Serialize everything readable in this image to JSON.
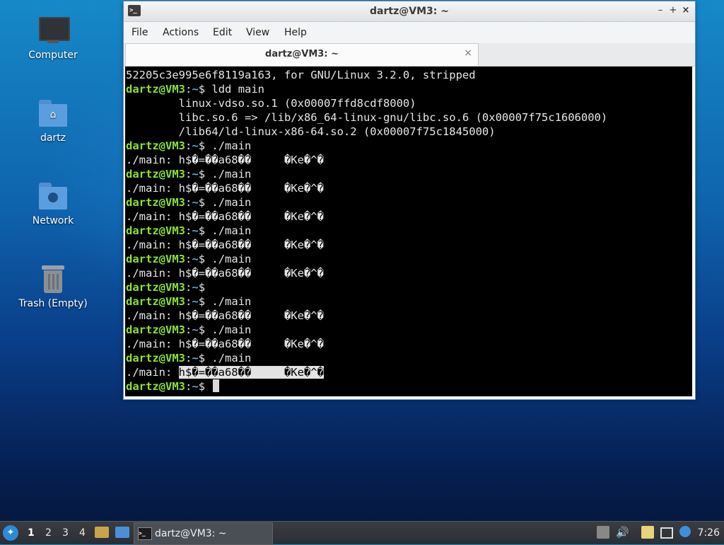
{
  "desktop": {
    "icons": [
      {
        "label": "Computer"
      },
      {
        "label": "dartz"
      },
      {
        "label": "Network"
      },
      {
        "label": "Trash (Empty)"
      }
    ]
  },
  "window": {
    "title": "dartz@VM3: ~",
    "controls": {
      "minimize": "–",
      "maximize": "+",
      "close": "×"
    },
    "menu": [
      "File",
      "Actions",
      "Edit",
      "View",
      "Help"
    ],
    "tab": {
      "label": "dartz@VM3: ~",
      "close": "×"
    }
  },
  "terminal": {
    "lines": [
      {
        "text": "52205c3e995e6f8119a163, for GNU/Linux 3.2.0, stripped"
      },
      {
        "user": "dartz@VM3",
        "path": "~",
        "cmd": " ldd main"
      },
      {
        "text": "        linux-vdso.so.1 (0x00007ffd8cdf8000)"
      },
      {
        "text": "        libc.so.6 => /lib/x86_64-linux-gnu/libc.so.6 (0x00007f75c1606000)"
      },
      {
        "text": "        /lib64/ld-linux-x86-64.so.2 (0x00007f75c1845000)"
      },
      {
        "user": "dartz@VM3",
        "path": "~",
        "cmd": " ./main"
      },
      {
        "text": "./main: h$�=��a68��     �Ke�^�"
      },
      {
        "user": "dartz@VM3",
        "path": "~",
        "cmd": " ./main"
      },
      {
        "text": "./main: h$�=��a68��     �Ke�^�"
      },
      {
        "user": "dartz@VM3",
        "path": "~",
        "cmd": " ./main"
      },
      {
        "text": "./main: h$�=��a68��     �Ke�^�"
      },
      {
        "user": "dartz@VM3",
        "path": "~",
        "cmd": " ./main"
      },
      {
        "text": "./main: h$�=��a68��     �Ke�^�"
      },
      {
        "user": "dartz@VM3",
        "path": "~",
        "cmd": " ./main"
      },
      {
        "text": "./main: h$�=��a68��     �Ke�^�"
      },
      {
        "user": "dartz@VM3",
        "path": "~",
        "cmd": ""
      },
      {
        "user": "dartz@VM3",
        "path": "~",
        "cmd": " ./main"
      },
      {
        "text": "./main: h$�=��a68��     �Ke�^�"
      },
      {
        "user": "dartz@VM3",
        "path": "~",
        "cmd": " ./main"
      },
      {
        "text": "./main: h$�=��a68��     �Ke�^�"
      },
      {
        "user": "dartz@VM3",
        "path": "~",
        "cmd": " ./main"
      },
      {
        "text": "./main: ",
        "selected": "h$�=��a68��     �Ke�^�"
      },
      {
        "user": "dartz@VM3",
        "path": "~",
        "cmd": " ",
        "cursor": true
      }
    ]
  },
  "taskbar": {
    "workspaces": [
      "1",
      "2",
      "3",
      "4"
    ],
    "active_workspace": "1",
    "task": {
      "label": "dartz@VM3: ~"
    },
    "clock": "7:26"
  },
  "colors": {
    "prompt_user": "#8ae234",
    "prompt_path": "#729fcf",
    "terminal_bg": "#000000",
    "taskbar_bg": "#2b2e33"
  }
}
